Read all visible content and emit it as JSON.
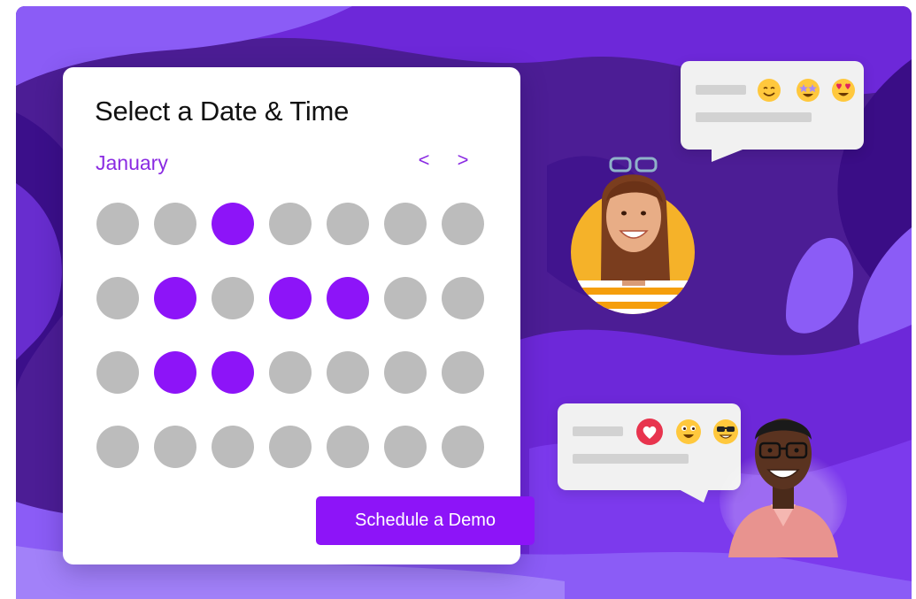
{
  "calendar": {
    "title": "Select a Date & Time",
    "month": "January",
    "prev_label": "<",
    "next_label": ">",
    "cta_label": "Schedule a Demo",
    "rows": [
      [
        false,
        false,
        true,
        false,
        false,
        false,
        false
      ],
      [
        false,
        true,
        false,
        true,
        true,
        false,
        false
      ],
      [
        false,
        true,
        true,
        false,
        false,
        false,
        false
      ],
      [
        false,
        false,
        false,
        false,
        false,
        false,
        false
      ]
    ]
  },
  "colors": {
    "accent": "#8d14f8",
    "unavailable_day": "#bcbcbc",
    "background_purple": "#5b21b6"
  },
  "chat_top": {
    "icons": [
      "smiling-face-emoji-icon",
      "star-struck-emoji-icon",
      "heart-eyes-emoji-icon"
    ]
  },
  "chat_bottom": {
    "icons": [
      "heart-reaction-icon",
      "grinning-face-emoji-icon",
      "sunglasses-face-emoji-icon"
    ]
  }
}
